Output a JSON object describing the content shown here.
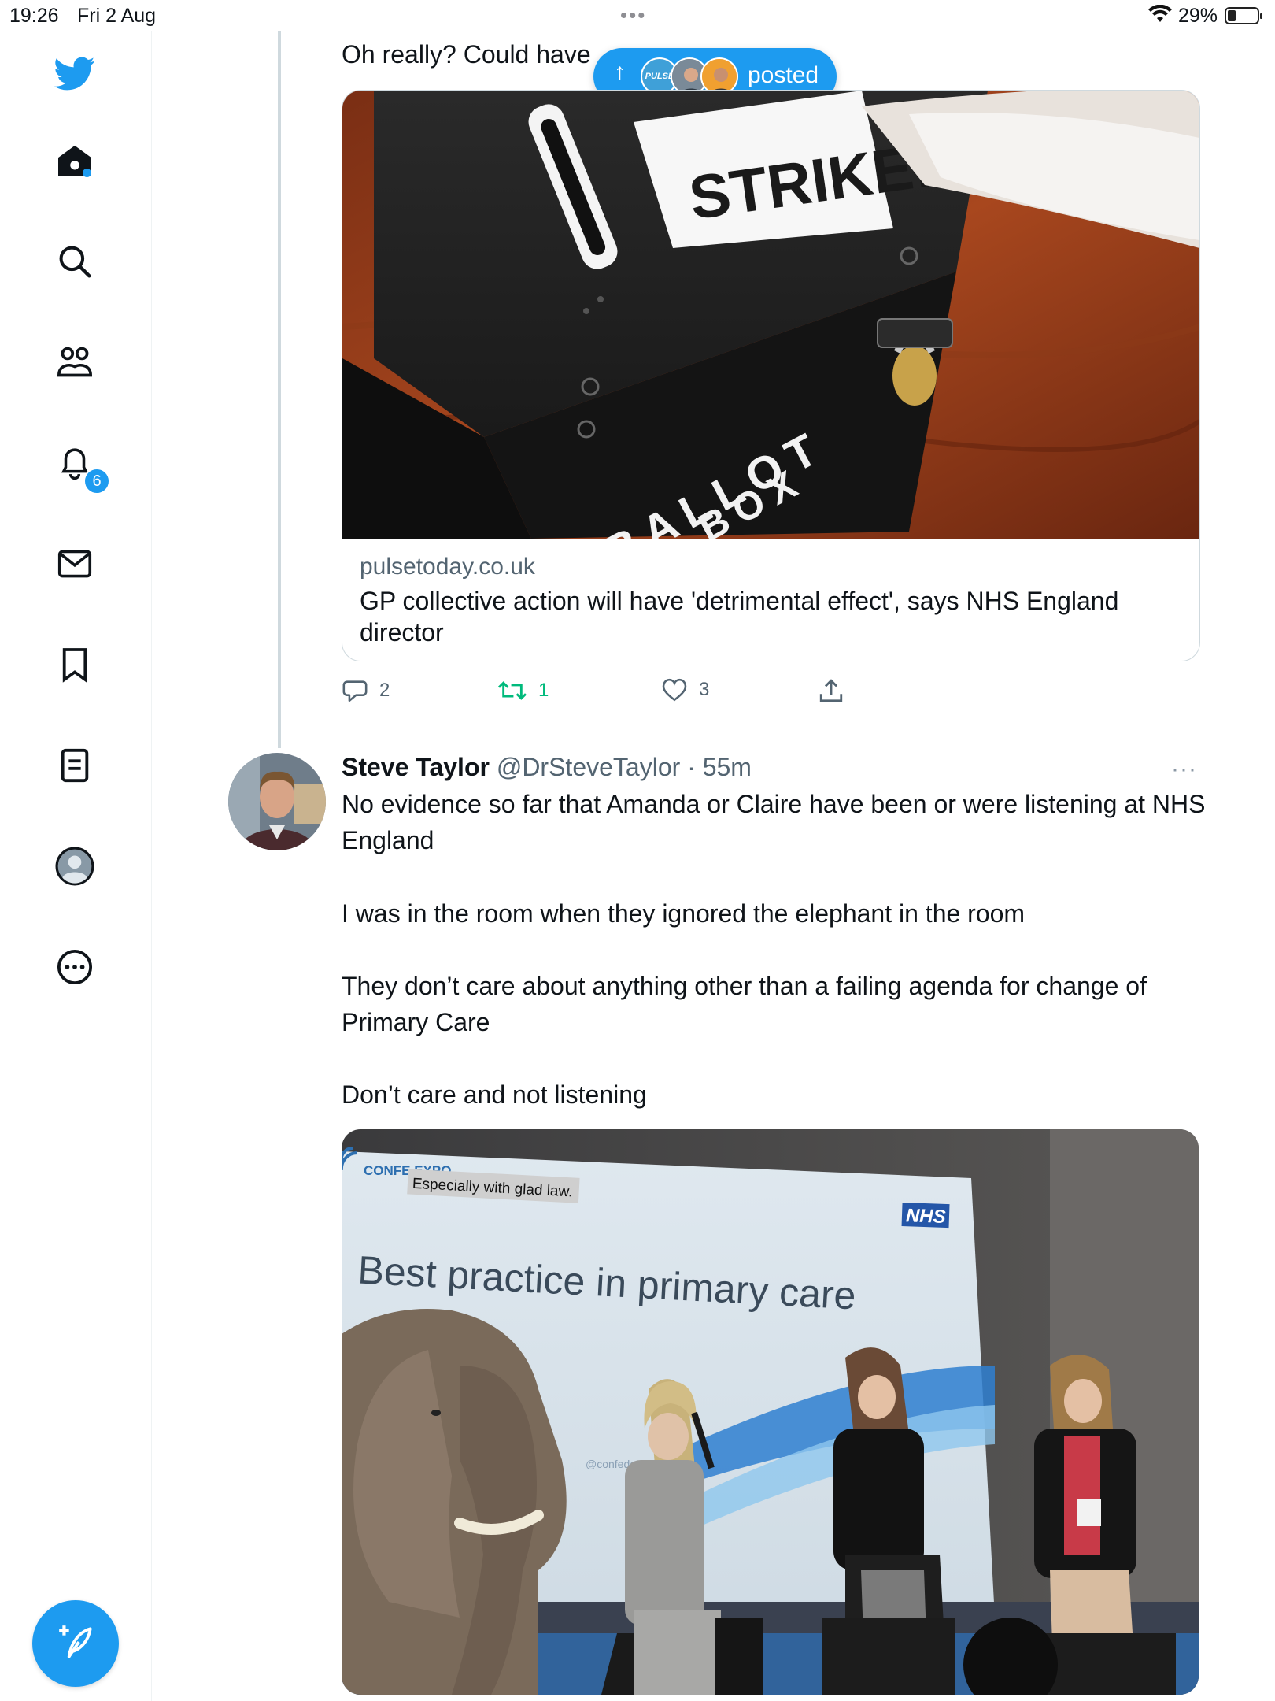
{
  "status_bar": {
    "time": "19:26",
    "date": "Fri 2 Aug",
    "battery": "29%",
    "battery_level": 0.29
  },
  "sidebar": {
    "items": [
      {
        "icon": "twitter-bird-icon"
      },
      {
        "icon": "home-icon"
      },
      {
        "icon": "search-icon"
      },
      {
        "icon": "communities-icon"
      },
      {
        "icon": "bell-icon",
        "badge": "6"
      },
      {
        "icon": "mail-icon"
      },
      {
        "icon": "bookmark-icon"
      },
      {
        "icon": "lists-icon"
      },
      {
        "icon": "profile-icon"
      },
      {
        "icon": "more-circle-icon"
      }
    ],
    "compose": {
      "icon": "feather-plus-icon"
    }
  },
  "new_posts_pill": {
    "label": "posted",
    "logo_text": "PULSE"
  },
  "tweet1": {
    "text": "Oh really? Could have",
    "card": {
      "domain": "pulsetoday.co.uk",
      "title": "GP collective action will have 'detrimental effect', says NHS England director",
      "image": {
        "sign_text": "STRIKE!",
        "box_line1": "BALLOT",
        "box_line2": "BOX"
      }
    },
    "actions": {
      "replies": "2",
      "retweets": "1",
      "likes": "3"
    }
  },
  "tweet2": {
    "name": "Steve Taylor",
    "handle": "@DrSteveTaylor",
    "separator": "·",
    "time": "55m",
    "more": "···",
    "paragraphs": [
      "No evidence so far that Amanda or Claire have been or were listening at NHS England",
      "I was in the room when they ignored the elephant in the room",
      "They don’t care about anything other than a failing agenda for change of Primary Care",
      "Don’t care and not listening"
    ],
    "photo": {
      "screen_title": "Best practice in primary care",
      "nhs_logo": "NHS",
      "expo_text": "CONFE EXPO",
      "caption": "Especially with glad law.",
      "handle": "@confedexpo"
    }
  }
}
